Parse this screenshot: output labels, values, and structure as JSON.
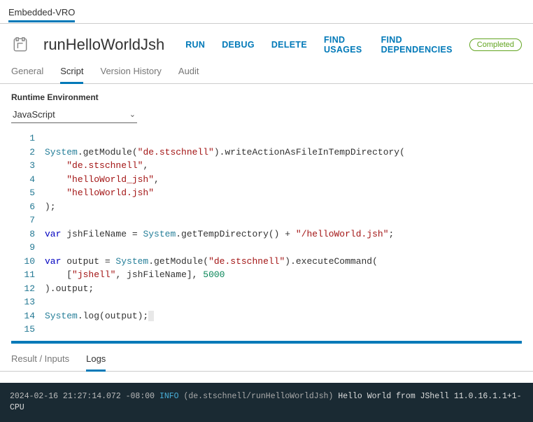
{
  "topTab": "Embedded-VRO",
  "title": "runHelloWorldJsh",
  "actions": {
    "run": "RUN",
    "debug": "DEBUG",
    "delete": "DELETE",
    "findUsages": "FIND USAGES",
    "findDeps": "FIND DEPENDENCIES"
  },
  "status": "Completed",
  "tabs": {
    "general": "General",
    "script": "Script",
    "version": "Version History",
    "audit": "Audit"
  },
  "runtime": {
    "label": "Runtime Environment",
    "value": "JavaScript"
  },
  "code": {
    "l1": "",
    "l2a": "System",
    "l2b": ".getModule(",
    "l2c": "\"de.stschnell\"",
    "l2d": ").writeActionAsFileInTempDirectory(",
    "l3": "\"de.stschnell\"",
    "l3p": ",",
    "l4": "\"helloWorld_jsh\"",
    "l4p": ",",
    "l5": "\"helloWorld.jsh\"",
    "l6": ");",
    "l7": "",
    "l8a": "var",
    "l8b": " jshFileName = ",
    "l8c": "System",
    "l8d": ".getTempDirectory() + ",
    "l8e": "\"/helloWorld.jsh\"",
    "l8f": ";",
    "l9": "",
    "l10a": "var",
    "l10b": " output = ",
    "l10c": "System",
    "l10d": ".getModule(",
    "l10e": "\"de.stschnell\"",
    "l10f": ").executeCommand(",
    "l11a": "[",
    "l11b": "\"jshell\"",
    "l11c": ", jshFileName], ",
    "l11d": "5000",
    "l12": ").output;",
    "l13": "",
    "l14a": "System",
    "l14b": ".log(output);",
    "l15": ""
  },
  "lineno": {
    "1": "1",
    "2": "2",
    "3": "3",
    "4": "4",
    "5": "5",
    "6": "6",
    "7": "7",
    "8": "8",
    "9": "9",
    "10": "10",
    "11": "11",
    "12": "12",
    "13": "13",
    "14": "14",
    "15": "15"
  },
  "subtabs": {
    "result": "Result / Inputs",
    "logs": "Logs"
  },
  "log": {
    "ts": "2024-02-16 21:27:14.072 -08:00",
    "level": "INFO",
    "ns": "(de.stschnell/runHelloWorldJsh)",
    "msg": "Hello World from JShell 11.0.16.1.1+1-CPU"
  }
}
